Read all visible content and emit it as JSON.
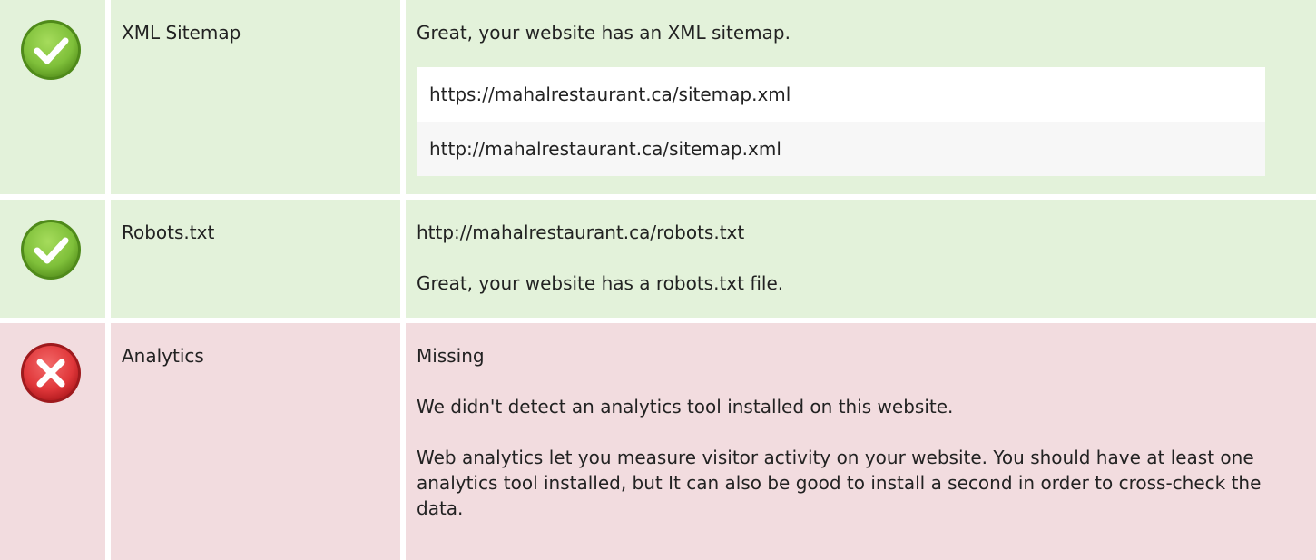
{
  "colors": {
    "pass_bg": "#e3f2da",
    "fail_bg": "#f2dcdf",
    "pass_icon": "#7fc03a",
    "fail_icon": "#e0373a"
  },
  "rows": [
    {
      "status": "pass",
      "icon": "check-circle-icon",
      "label": "XML Sitemap",
      "message": "Great, your website has an XML sitemap.",
      "urls": [
        "https://mahalrestaurant.ca/sitemap.xml",
        "http://mahalrestaurant.ca/sitemap.xml"
      ]
    },
    {
      "status": "pass",
      "icon": "check-circle-icon",
      "label": "Robots.txt",
      "url": "http://mahalrestaurant.ca/robots.txt",
      "message": "Great, your website has a robots.txt file."
    },
    {
      "status": "fail",
      "icon": "cross-circle-icon",
      "label": "Analytics",
      "value": "Missing",
      "message": "We didn't detect an analytics tool installed on this website.",
      "advice": "Web analytics let you measure visitor activity on your website. You should have at least one analytics tool installed, but It can also be good to install a second in order to cross-check the data."
    }
  ]
}
